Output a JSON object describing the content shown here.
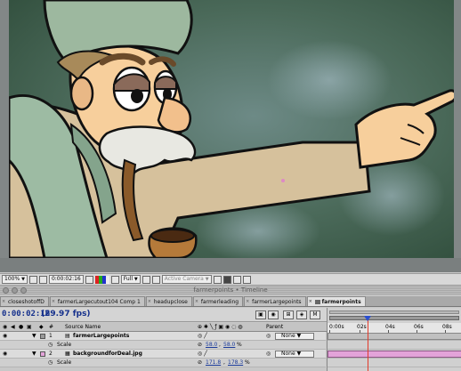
{
  "viewer": {
    "zoom": "100%",
    "timecode": "0:00:02:16",
    "resolution": "Full",
    "camera": "Active Camera"
  },
  "colors": {
    "background_top": "#3e5a47",
    "coat": "#d6c19c",
    "scarf": "#9dbba3",
    "skin": "#f7cf9c",
    "beard": "#e8e8e2",
    "hat": "#9db89f",
    "timecode_blue": "#15308c",
    "layer2_bar": "#e3a3d9",
    "time_indicator": "#e23a2a"
  },
  "timeline": {
    "window_title": "farmerpoints • Timeline",
    "tabs": [
      {
        "label": "closeshotoffD",
        "active": false
      },
      {
        "label": "farmerLargecutout104 Comp 1",
        "active": false
      },
      {
        "label": "headupclose",
        "active": false
      },
      {
        "label": "farmerleading",
        "active": false
      },
      {
        "label": "farmerLargepoints",
        "active": false
      },
      {
        "label": "farmerpoints",
        "active": true
      }
    ],
    "current_time": "0:00:02:16",
    "fps": "(29.97 fps)",
    "columns": {
      "number": "#",
      "source_name": "Source Name",
      "parent": "Parent"
    },
    "layers": [
      {
        "index": "1",
        "name": "farmerLargepoints",
        "property": "Scale",
        "scale": [
          "58.0",
          "58.0"
        ],
        "unit": "%",
        "parent": "None",
        "label_color": "#9a9a9a"
      },
      {
        "index": "2",
        "name": "backgroundforDeal.jpg",
        "property": "Scale",
        "scale": [
          "171.8",
          "178.3"
        ],
        "unit": "%",
        "parent": "None",
        "label_color": "#e3a3d9"
      }
    ],
    "ruler_ticks": [
      "0:00s",
      "02s",
      "04s",
      "06s",
      "08s"
    ],
    "current_time_fraction": 0.3
  }
}
